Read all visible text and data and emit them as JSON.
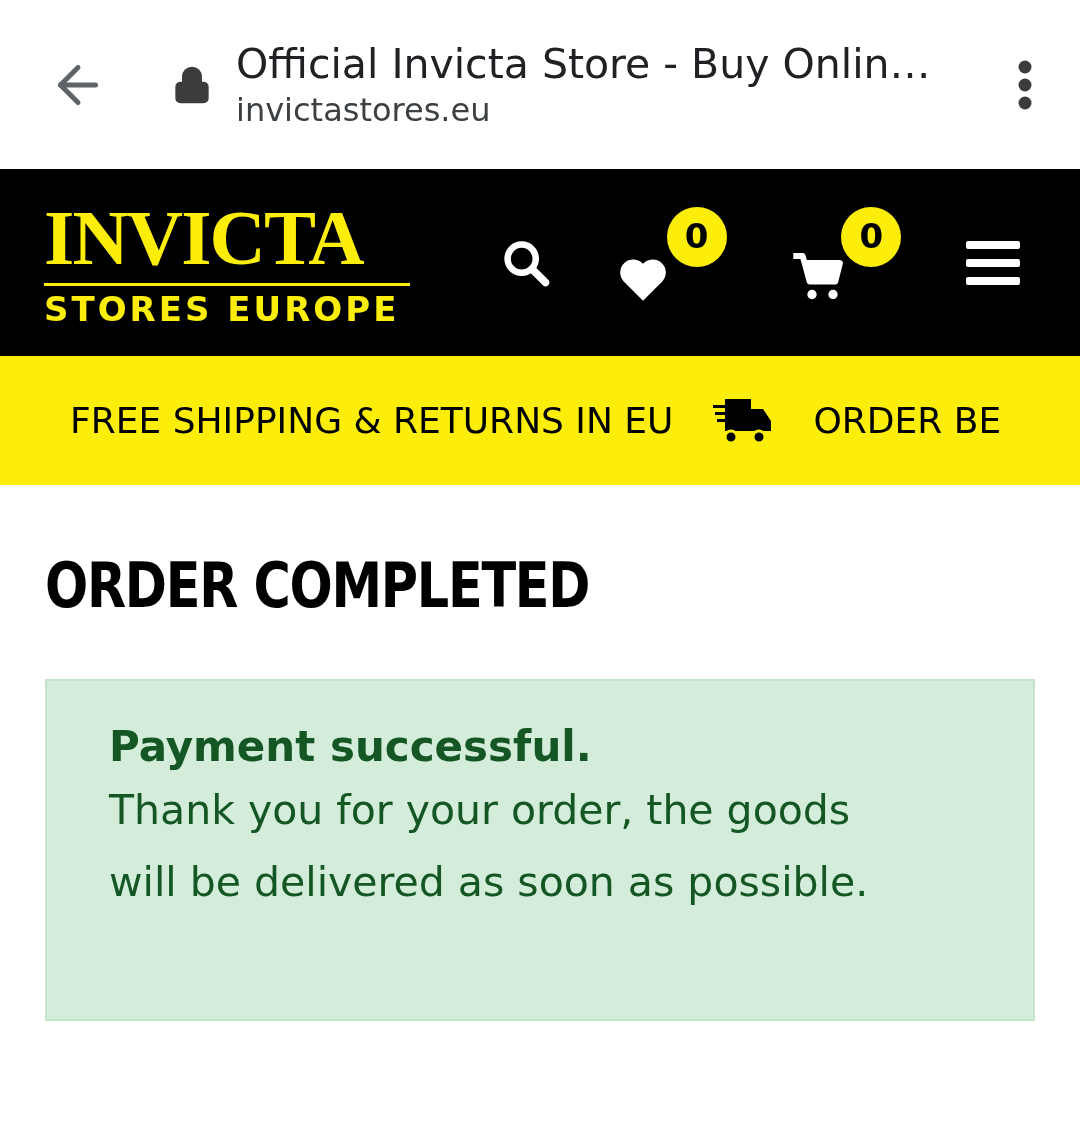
{
  "browser_bar": {
    "title": "Official Invicta Store - Buy Onlin…",
    "url": "invictastores.eu"
  },
  "header": {
    "logo_title": "INVICTA",
    "logo_subtitle": "STORES EUROPE",
    "wishlist_count": "0",
    "cart_count": "0"
  },
  "promo_bar": {
    "items": [
      "FREE SHIPPING & RETURNS IN EU",
      "ORDER BE"
    ]
  },
  "page_title": "ORDER COMPLETED",
  "alert": {
    "heading": "Payment successful.",
    "message": "Thank you for your order, the goods will be delivered as soon as possible."
  }
}
